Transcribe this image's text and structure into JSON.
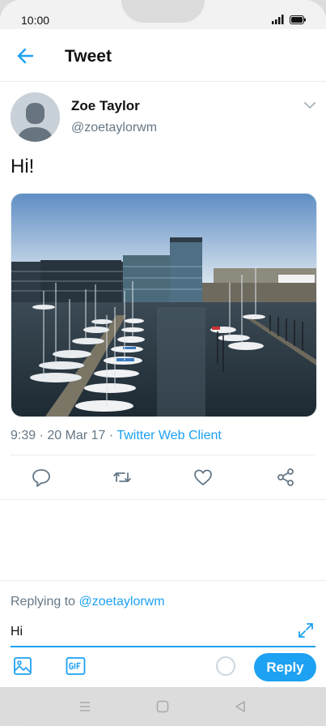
{
  "status_bar": {
    "time": "10:00"
  },
  "header": {
    "title": "Tweet",
    "back_icon": "back-arrow-icon"
  },
  "tweet": {
    "author_name": "Zoe Taylor",
    "author_handle": "@zoetaylorwm",
    "text": "Hi!",
    "timestamp": "9:39 · 20 Mar 17 · ",
    "client": "Twitter Web Client",
    "photo_subject": "marina-photo"
  },
  "actions": [
    "reply-icon",
    "retweet-icon",
    "like-icon",
    "share-icon"
  ],
  "reply": {
    "replying_prefix": "Replying to ",
    "replying_handle": "@zoetaylorwm",
    "input_value": "Hi",
    "button_label": "Reply"
  },
  "colors": {
    "accent": "#1da1f2",
    "secondary_text": "#657786",
    "divider": "#e6ecf0"
  }
}
